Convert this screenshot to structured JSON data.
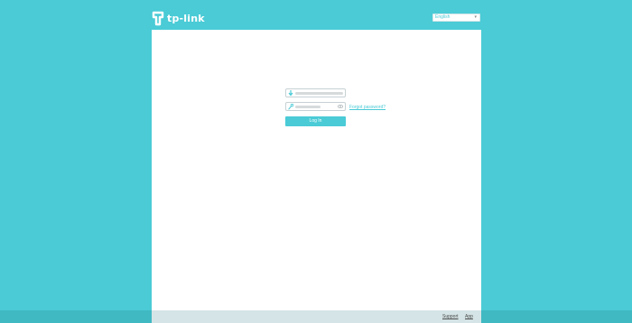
{
  "brand": {
    "logo_text": "tp-link"
  },
  "language": {
    "selected": "English"
  },
  "login": {
    "forgot_password": "Forgot password?",
    "login_button": "Log In"
  },
  "footer": {
    "support": "Support",
    "app": "App"
  },
  "colors": {
    "accent": "#4acbd6",
    "footer_bar": "#d5e4e6"
  }
}
